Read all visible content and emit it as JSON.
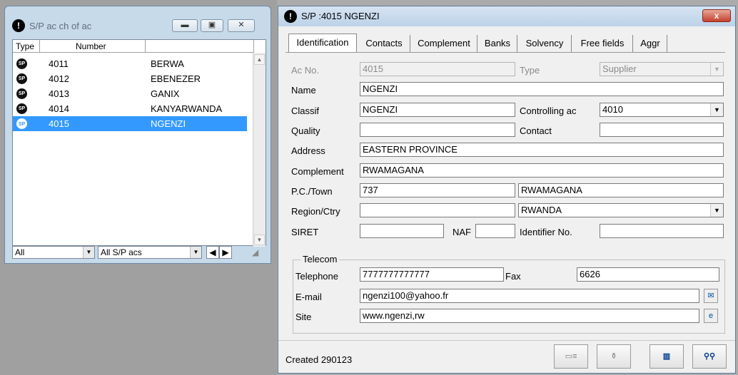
{
  "list_window": {
    "title": "S/P ac ch of ac",
    "columns": [
      "Type",
      "Number"
    ],
    "rows": [
      {
        "number": "4011",
        "name": "BERWA"
      },
      {
        "number": "4012",
        "name": "EBENEZER"
      },
      {
        "number": "4013",
        "name": "GANIX"
      },
      {
        "number": "4014",
        "name": "KANYARWANDA"
      },
      {
        "number": "4015",
        "name": "NGENZI"
      }
    ],
    "filter1": "All",
    "filter2": "All S/P acs"
  },
  "main_window": {
    "title": "S/P :4015 NGENZI",
    "close_label": "x",
    "tabs": [
      "Identification",
      "Contacts",
      "Complement",
      "Banks",
      "Solvency",
      "Free fields",
      "Aggr"
    ],
    "fields": {
      "ac_no_label": "Ac No.",
      "ac_no": "4015",
      "type_label": "Type",
      "type": "Supplier",
      "name_label": "Name",
      "name": "NGENZI",
      "classif_label": "Classif",
      "classif": "NGENZI",
      "controlling_label": "Controlling ac",
      "controlling": "4010",
      "quality_label": "Quality",
      "quality": "",
      "contact_label": "Contact",
      "contact": "",
      "address_label": "Address",
      "address": "EASTERN PROVINCE",
      "complement_label": "Complement",
      "complement": "RWAMAGANA",
      "pc_town_label": "P.C./Town",
      "pc": "737",
      "town": "RWAMAGANA",
      "region_label": "Region/Ctry",
      "region": "",
      "country": "RWANDA",
      "siret_label": "SIRET",
      "siret": "",
      "naf_label": "NAF",
      "naf": "",
      "identifier_label": "Identifier No.",
      "identifier": ""
    },
    "telecom": {
      "group_label": "Telecom",
      "telephone_label": "Telephone",
      "telephone": "7777777777777",
      "fax_label": "Fax",
      "fax": "6626",
      "email_label": "E-mail",
      "email": "ngenzi100@yahoo.fr",
      "site_label": "Site",
      "site": "www.ngenzi,rw"
    },
    "status": "Created 290123"
  }
}
